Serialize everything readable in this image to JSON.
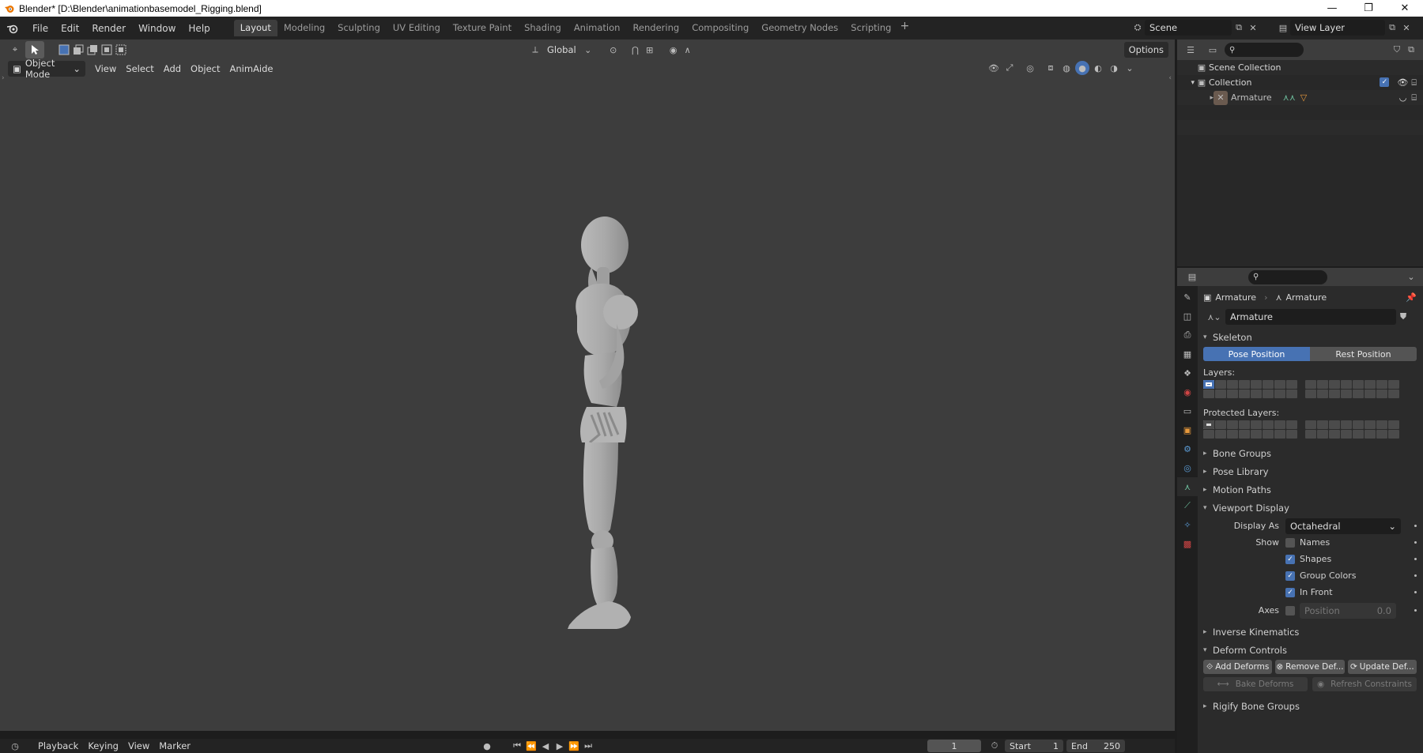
{
  "window": {
    "title": "Blender* [D:\\Blender\\animationbasemodel_Rigging.blend]",
    "controls": [
      "—",
      "❐",
      "✕"
    ]
  },
  "menu": [
    "File",
    "Edit",
    "Render",
    "Window",
    "Help"
  ],
  "workspaces": [
    {
      "label": "Layout",
      "active": true
    },
    {
      "label": "Modeling"
    },
    {
      "label": "Sculpting"
    },
    {
      "label": "UV Editing"
    },
    {
      "label": "Texture Paint"
    },
    {
      "label": "Shading"
    },
    {
      "label": "Animation"
    },
    {
      "label": "Rendering"
    },
    {
      "label": "Compositing"
    },
    {
      "label": "Geometry Nodes"
    },
    {
      "label": "Scripting"
    }
  ],
  "scene": {
    "label": "Scene"
  },
  "view_layer": {
    "label": "View Layer"
  },
  "viewport": {
    "transform_orientation": "Global",
    "options_label": "Options",
    "mode": "Object Mode",
    "header_menu": [
      "View",
      "Select",
      "Add",
      "Object",
      "AnimAide"
    ]
  },
  "outliner": {
    "rows": [
      {
        "label": "Scene Collection",
        "indent": 0
      },
      {
        "label": "Collection",
        "indent": 1
      },
      {
        "label": "Armature",
        "indent": 2
      }
    ]
  },
  "properties": {
    "breadcrumb": [
      "Armature",
      "Armature"
    ],
    "datablock_name": "Armature",
    "skeleton": {
      "title": "Skeleton",
      "pose_position": "Pose Position",
      "rest_position": "Rest Position",
      "layers_label": "Layers:",
      "protected_label": "Protected Layers:"
    },
    "collapsed_panels": [
      "Bone Groups",
      "Pose Library",
      "Motion Paths"
    ],
    "viewport_display": {
      "title": "Viewport Display",
      "display_as_label": "Display As",
      "display_as_value": "Octahedral",
      "show_label": "Show",
      "show_options": [
        {
          "label": "Names",
          "checked": false
        },
        {
          "label": "Shapes",
          "checked": true
        },
        {
          "label": "Group Colors",
          "checked": true
        },
        {
          "label": "In Front",
          "checked": true
        }
      ],
      "axes_label": "Axes",
      "position_label": "Position",
      "position_value": "0.0"
    },
    "inverse_kinematics": "Inverse Kinematics",
    "deform_controls": {
      "title": "Deform Controls",
      "add": "Add Deforms",
      "remove": "Remove Def...",
      "update": "Update Def...",
      "bake": "Bake Deforms",
      "refresh": "Refresh Constraints"
    },
    "rigify": "Rigify Bone Groups"
  },
  "timeline": {
    "menu": [
      "Playback",
      "Keying",
      "View",
      "Marker"
    ],
    "current_frame": "1",
    "start_label": "Start",
    "start": "1",
    "end_label": "End",
    "end": "250"
  },
  "colors": {
    "accent": "#4772b3",
    "viewport_bg": "#3d3d3d",
    "panel_bg": "#2b2b2b"
  }
}
